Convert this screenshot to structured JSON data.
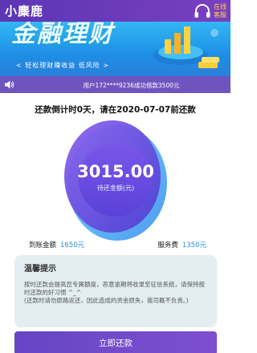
{
  "header": {
    "title": "小麋鹿",
    "support_line1": "在线",
    "support_line2": "客服",
    "support_icon": "headset-icon"
  },
  "banner": {
    "headline": "金融理财",
    "subline": "< 轻松理财赚收益   低风险 >"
  },
  "notice": {
    "icon": "speaker-icon",
    "text": "用户172****9236成功借款3500元"
  },
  "repayment": {
    "countdown": "还款倒计时0天，请在2020-07-07前还款",
    "amount": "3015.00",
    "amount_label": "待还金额(元)",
    "received_label": "到账金额",
    "received_value": "1650元",
    "fee_label": "服务费",
    "fee_value": "1350元"
  },
  "tips": {
    "title": "温馨提示",
    "body": "按时还款会提高您专属额度，恶意逾期将收录至征信系统，请保持按时还款的好习惯 ^_^\n(还款时请勿原路返还，因此造成的资金损失，我司概不负责。)"
  },
  "actions": {
    "repay_label": "立即还款"
  },
  "colors": {
    "header": "#5b36b5",
    "accent_blue": "#2a8ee6",
    "button": "#6a4ac6",
    "ring_outer": "#3fb6f2",
    "ring_inner": "#6a4be0"
  }
}
